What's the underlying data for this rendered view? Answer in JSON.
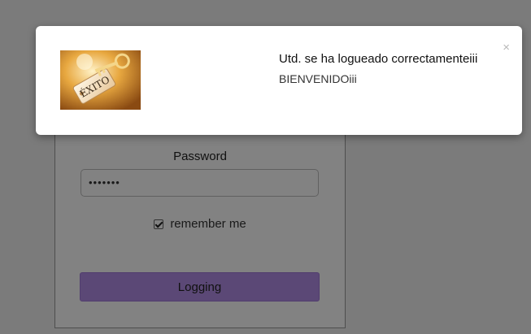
{
  "login": {
    "password_label": "Password",
    "password_value": "•••••••",
    "remember_label": "remember me",
    "remember_checked": true,
    "submit_label": "Logging"
  },
  "modal": {
    "title": "Utd. se ha logueado correctamenteiii",
    "message": "BIENVENIDOiii",
    "close_glyph": "×",
    "image_icon": "exito-keys-image"
  },
  "colors": {
    "button": "#b38ee8",
    "overlay": "rgba(0,0,0,0.49)"
  }
}
